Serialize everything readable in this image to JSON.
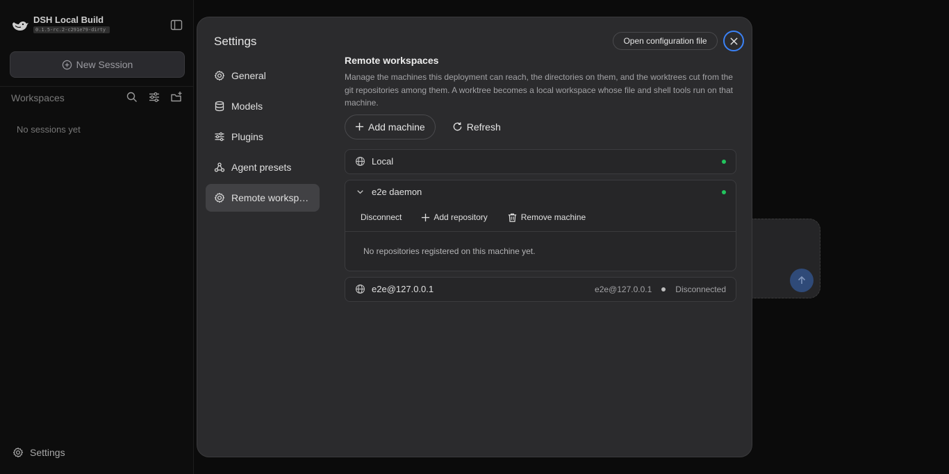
{
  "app": {
    "title": "DSH Local Build",
    "version": "0.1.5-rc.2-c291e79-dirty"
  },
  "sidebar": {
    "new_session_label": "New Session",
    "workspaces_label": "Workspaces",
    "empty_text": "No sessions yet",
    "settings_label": "Settings"
  },
  "modal": {
    "title": "Settings",
    "open_config_label": "Open configuration file",
    "nav": [
      {
        "label": "General",
        "icon": "gear-icon"
      },
      {
        "label": "Models",
        "icon": "database-icon"
      },
      {
        "label": "Plugins",
        "icon": "sliders-icon"
      },
      {
        "label": "Agent presets",
        "icon": "agents-icon"
      },
      {
        "label": "Remote workspaces",
        "icon": "gear-icon",
        "active": true
      }
    ],
    "content": {
      "title": "Remote workspaces",
      "description": "Manage the machines this deployment can reach, the directories on them, and the worktrees cut from the git repositories among them. A worktree becomes a local workspace whose file and shell tools run on that machine.",
      "add_machine_label": "Add machine",
      "refresh_label": "Refresh",
      "machines": [
        {
          "name": "Local",
          "status_color": "#22c55e"
        },
        {
          "name": "e2e daemon",
          "expanded": true,
          "status_color": "#22c55e",
          "actions": [
            "Disconnect",
            "Add repository",
            "Remove machine"
          ],
          "empty_text": "No repositories registered on this machine yet."
        },
        {
          "name": "e2e@127.0.0.1",
          "host": "e2e@127.0.0.1",
          "status": "Disconnected",
          "status_color": "#bdbdbd"
        }
      ]
    }
  }
}
